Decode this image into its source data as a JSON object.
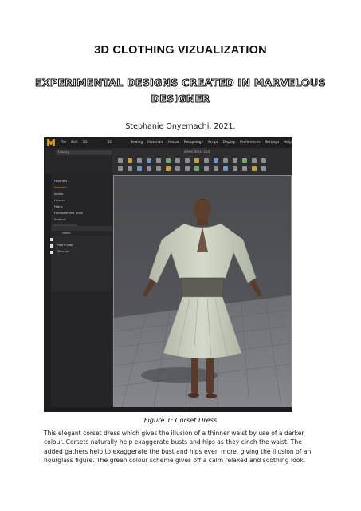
{
  "document": {
    "title": "3D CLOTHING VIZUALIZATION",
    "subtitle_line1": "EXPERIMENTAL DESIGNS CREATED IN MARVELOUS",
    "subtitle_line2": "DESIGNER",
    "author": "Stephanie Onyemachi, 2021.",
    "figure_caption": "Figure 1: Corset Dress",
    "paragraph": "This elegant corset dress which gives the illusion of a thinner waist by use of a darker colour. Corsets naturally help exaggerate busts and hips as they cinch the waist. The added gathers help to exaggerate the bust and hips even more, giving the illusion of an hourglass figure. The green colour scheme gives off a calm relaxed and soothing look."
  },
  "app": {
    "logo": "M",
    "menu": [
      "File",
      "Edit",
      "3D Garment",
      "2D Pattern",
      "Sewing",
      "Materials",
      "Avatar",
      "Retopology",
      "Script",
      "Display",
      "Preferences",
      "Settings",
      "Help"
    ],
    "library_dropdown": "Library",
    "window_title": "green dress.zprj",
    "library_items": [
      "Favorites",
      "Garment",
      "Avatar",
      "Hanger",
      "Fabric",
      "Hardware and Trims",
      "Analysis"
    ],
    "object_browser_header": "Name",
    "object_items": [
      "",
      "Fabric.zfab",
      "Trim.zprj"
    ],
    "accent_color": "#e8a21a",
    "dress_color": "#c7cdbd",
    "corset_color": "#5d5d55"
  }
}
